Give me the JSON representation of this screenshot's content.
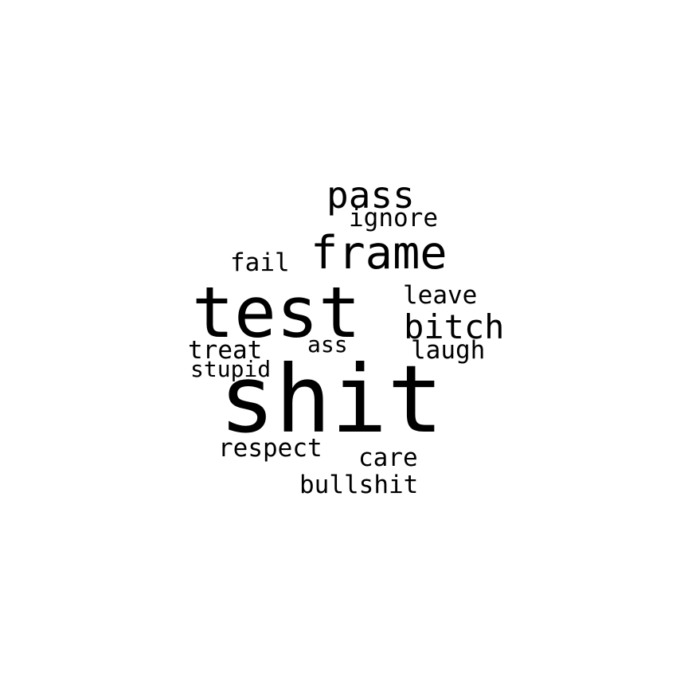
{
  "words": [
    {
      "id": "shit",
      "text": "shit"
    },
    {
      "id": "test",
      "text": "test"
    },
    {
      "id": "frame",
      "text": "frame"
    },
    {
      "id": "pass",
      "text": "pass"
    },
    {
      "id": "bitch",
      "text": "bitch"
    },
    {
      "id": "ignore",
      "text": "ignore"
    },
    {
      "id": "fail",
      "text": "fail"
    },
    {
      "id": "leave",
      "text": "leave"
    },
    {
      "id": "laugh",
      "text": "laugh"
    },
    {
      "id": "treat",
      "text": "treat"
    },
    {
      "id": "ass",
      "text": "ass"
    },
    {
      "id": "stupid",
      "text": "stupid"
    },
    {
      "id": "respect",
      "text": "respect"
    },
    {
      "id": "care",
      "text": "care"
    },
    {
      "id": "bullshit",
      "text": "bullshit"
    }
  ]
}
